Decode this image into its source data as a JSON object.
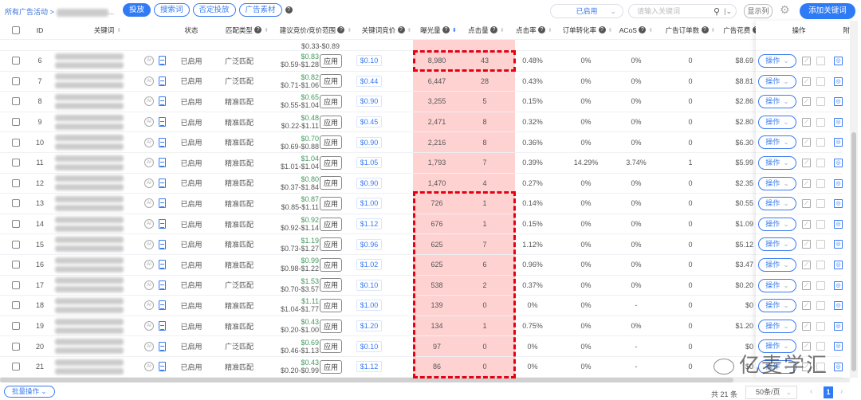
{
  "breadcrumb": {
    "root": "所有广告活动",
    "sep": ">",
    "tail": "..."
  },
  "tabs": [
    {
      "label": "投放",
      "active": true
    },
    {
      "label": "搜索词"
    },
    {
      "label": "否定投放"
    },
    {
      "label": "广告素材"
    }
  ],
  "toolbar": {
    "status_value": "已启用",
    "search_placeholder": "请输入关键词",
    "columns_label": "显示列",
    "add_label": "添加关键词"
  },
  "headers": {
    "id": "ID",
    "keyword": "关键词",
    "status": "状态",
    "match": "匹配类型",
    "suggested": "建议竞价/竞价范围",
    "bid": "关键词竞价",
    "impressions": "曝光量",
    "clicks": "点击量",
    "ctr": "点击率",
    "cvr": "订单转化率",
    "acos": "ACoS",
    "orders": "广告订单数",
    "spend": "广告花费",
    "ops": "操作",
    "extra": "附"
  },
  "partial_row": {
    "range": "$0.33-$0.89"
  },
  "common": {
    "status": "已启用",
    "apply": "应用",
    "ops": "操作",
    "ai": "AI"
  },
  "rows": [
    {
      "id": "6",
      "match": "广泛匹配",
      "sug": "$0.83",
      "range": "$0.59-$1.28",
      "bid": "$0.10",
      "imp": "8,980",
      "clk": "43",
      "ctr": "0.48%",
      "cvr": "0%",
      "acos": "0%",
      "ord": "0",
      "spend": "$8.69"
    },
    {
      "id": "7",
      "match": "广泛匹配",
      "sug": "$0.82",
      "range": "$0.71-$1.06",
      "bid": "$0.44",
      "imp": "6,447",
      "clk": "28",
      "ctr": "0.43%",
      "cvr": "0%",
      "acos": "0%",
      "ord": "0",
      "spend": "$8.81"
    },
    {
      "id": "8",
      "match": "精准匹配",
      "sug": "$0.65",
      "range": "$0.55-$1.04",
      "bid": "$0.90",
      "imp": "3,255",
      "clk": "5",
      "ctr": "0.15%",
      "cvr": "0%",
      "acos": "0%",
      "ord": "0",
      "spend": "$2.86"
    },
    {
      "id": "9",
      "match": "精准匹配",
      "sug": "$0.48",
      "range": "$0.22-$1.11",
      "bid": "$0.45",
      "imp": "2,471",
      "clk": "8",
      "ctr": "0.32%",
      "cvr": "0%",
      "acos": "0%",
      "ord": "0",
      "spend": "$2.80"
    },
    {
      "id": "10",
      "match": "精准匹配",
      "sug": "$0.70",
      "range": "$0.69-$0.88",
      "bid": "$0.90",
      "imp": "2,216",
      "clk": "8",
      "ctr": "0.36%",
      "cvr": "0%",
      "acos": "0%",
      "ord": "0",
      "spend": "$6.30"
    },
    {
      "id": "11",
      "match": "精准匹配",
      "sug": "$1.04",
      "range": "$1.01-$1.04",
      "bid": "$1.05",
      "imp": "1,793",
      "clk": "7",
      "ctr": "0.39%",
      "cvr": "14.29%",
      "acos": "3.74%",
      "ord": "1",
      "spend": "$5.99"
    },
    {
      "id": "12",
      "match": "精准匹配",
      "sug": "$0.80",
      "range": "$0.37-$1.84",
      "bid": "$0.90",
      "imp": "1,470",
      "clk": "4",
      "ctr": "0.27%",
      "cvr": "0%",
      "acos": "0%",
      "ord": "0",
      "spend": "$2.35"
    },
    {
      "id": "13",
      "match": "精准匹配",
      "sug": "$0.87",
      "range": "$0.85-$1.11",
      "bid": "$1.00",
      "imp": "726",
      "clk": "1",
      "ctr": "0.14%",
      "cvr": "0%",
      "acos": "0%",
      "ord": "0",
      "spend": "$0.55"
    },
    {
      "id": "14",
      "match": "精准匹配",
      "sug": "$0.92",
      "range": "$0.92-$1.14",
      "bid": "$1.12",
      "imp": "676",
      "clk": "1",
      "ctr": "0.15%",
      "cvr": "0%",
      "acos": "0%",
      "ord": "0",
      "spend": "$1.09"
    },
    {
      "id": "15",
      "match": "精准匹配",
      "sug": "$1.19",
      "range": "$0.73-$1.27",
      "bid": "$0.96",
      "imp": "625",
      "clk": "7",
      "ctr": "1.12%",
      "cvr": "0%",
      "acos": "0%",
      "ord": "0",
      "spend": "$5.12"
    },
    {
      "id": "16",
      "match": "精准匹配",
      "sug": "$0.99",
      "range": "$0.98-$1.22",
      "bid": "$1.02",
      "imp": "625",
      "clk": "6",
      "ctr": "0.96%",
      "cvr": "0%",
      "acos": "0%",
      "ord": "0",
      "spend": "$3.47"
    },
    {
      "id": "17",
      "match": "广泛匹配",
      "sug": "$1.53",
      "range": "$0.70-$3.57",
      "bid": "$0.10",
      "imp": "538",
      "clk": "2",
      "ctr": "0.37%",
      "cvr": "0%",
      "acos": "0%",
      "ord": "0",
      "spend": "$0.20"
    },
    {
      "id": "18",
      "match": "精准匹配",
      "sug": "$1.11",
      "range": "$1.04-$1.77",
      "bid": "$1.00",
      "imp": "139",
      "clk": "0",
      "ctr": "0%",
      "cvr": "0%",
      "acos": "-",
      "ord": "0",
      "spend": "$0"
    },
    {
      "id": "19",
      "match": "精准匹配",
      "sug": "$0.43",
      "range": "$0.20-$1.00",
      "bid": "$1.20",
      "imp": "134",
      "clk": "1",
      "ctr": "0.75%",
      "cvr": "0%",
      "acos": "0%",
      "ord": "0",
      "spend": "$1.20"
    },
    {
      "id": "20",
      "match": "广泛匹配",
      "sug": "$0.69",
      "range": "$0.46-$1.13",
      "bid": "$0.10",
      "imp": "97",
      "clk": "0",
      "ctr": "0%",
      "cvr": "0%",
      "acos": "-",
      "ord": "0",
      "spend": "$0"
    },
    {
      "id": "21",
      "match": "精准匹配",
      "sug": "$0.43",
      "range": "$0.20-$0.99",
      "bid": "$1.12",
      "imp": "86",
      "clk": "0",
      "ctr": "0%",
      "cvr": "0%",
      "acos": "-",
      "ord": "0",
      "spend": "$0"
    }
  ],
  "footer": {
    "batch": "批量操作",
    "total": "共 21 条",
    "page_size": "50条/页",
    "page": "1"
  },
  "watermark": "亿麦学汇",
  "colors": {
    "accent": "#2f7bf5",
    "highlight": "#ffd2d2",
    "annotation": "#e60012"
  }
}
